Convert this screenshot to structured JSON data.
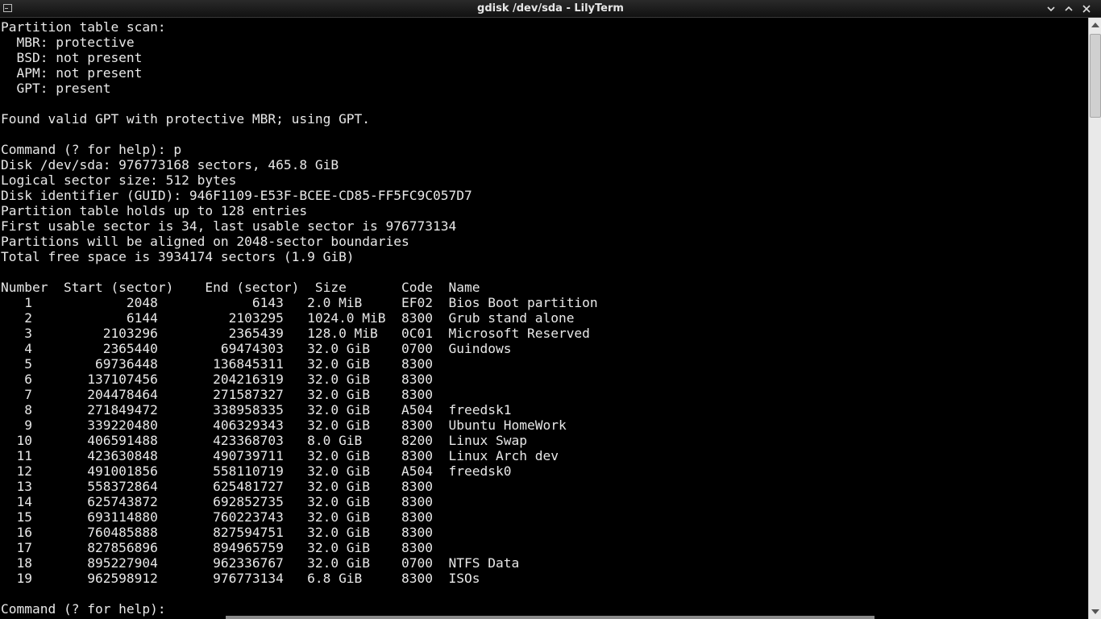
{
  "window": {
    "title": "gdisk /dev/sda - LilyTerm"
  },
  "terminal": {
    "lines": [
      "Partition table scan:",
      "  MBR: protective",
      "  BSD: not present",
      "  APM: not present",
      "  GPT: present",
      "",
      "Found valid GPT with protective MBR; using GPT.",
      "",
      "Command (? for help): p",
      "Disk /dev/sda: 976773168 sectors, 465.8 GiB",
      "Logical sector size: 512 bytes",
      "Disk identifier (GUID): 946F1109-E53F-BCEE-CD85-FF5FC9C057D7",
      "Partition table holds up to 128 entries",
      "First usable sector is 34, last usable sector is 976773134",
      "Partitions will be aligned on 2048-sector boundaries",
      "Total free space is 3934174 sectors (1.9 GiB)",
      "",
      "Number  Start (sector)    End (sector)  Size       Code  Name",
      "   1            2048            6143   2.0 MiB     EF02  Bios Boot partition",
      "   2            6144         2103295   1024.0 MiB  8300  Grub stand alone",
      "   3         2103296         2365439   128.0 MiB   0C01  Microsoft Reserved",
      "   4         2365440        69474303   32.0 GiB    0700  Guindows",
      "   5        69736448       136845311   32.0 GiB    8300  ",
      "   6       137107456       204216319   32.0 GiB    8300  ",
      "   7       204478464       271587327   32.0 GiB    8300  ",
      "   8       271849472       338958335   32.0 GiB    A504  freedsk1",
      "   9       339220480       406329343   32.0 GiB    8300  Ubuntu HomeWork",
      "  10       406591488       423368703   8.0 GiB     8200  Linux Swap",
      "  11       423630848       490739711   32.0 GiB    8300  Linux Arch dev",
      "  12       491001856       558110719   32.0 GiB    A504  freedsk0",
      "  13       558372864       625481727   32.0 GiB    8300  ",
      "  14       625743872       692852735   32.0 GiB    8300  ",
      "  15       693114880       760223743   32.0 GiB    8300  ",
      "  16       760485888       827594751   32.0 GiB    8300  ",
      "  17       827856896       894965759   32.0 GiB    8300  ",
      "  18       895227904       962336767   32.0 GiB    0700  NTFS Data",
      "  19       962598912       976773134   6.8 GiB     8300  ISOs",
      "",
      "Command (? for help): "
    ]
  },
  "icons": {
    "menu": "window-menu-icon",
    "minimize": "chevron-down-icon",
    "maximize": "chevron-up-icon",
    "close": "close-icon"
  },
  "colors": {
    "background": "#000000",
    "foreground": "#e8e8e8",
    "titlebar": "#1a1a1a",
    "scrollbar": "#e9e9e9"
  }
}
